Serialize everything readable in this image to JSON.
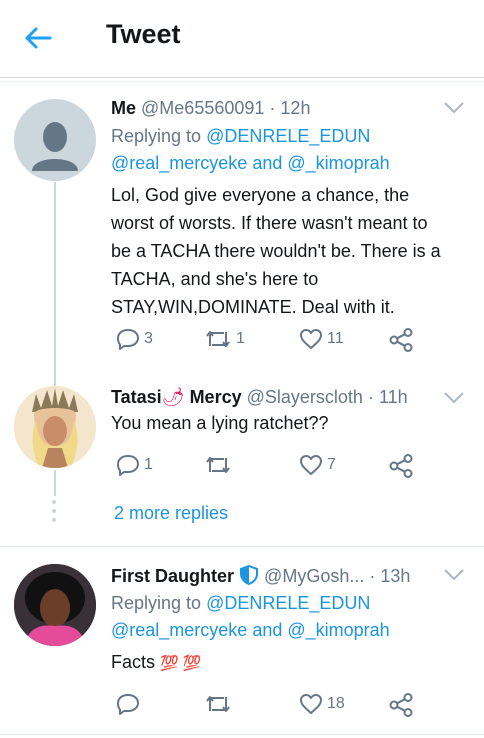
{
  "header": {
    "title": "Tweet",
    "back_icon": "arrow-left-icon"
  },
  "tweets": [
    {
      "name": "Me",
      "handle": "@Me65560091",
      "time": "· 12h",
      "replying_label": "Replying to",
      "replying_first": "@DENRELE_EDUN",
      "replying_second_line": "@real_mercyeke and @_kimoprah",
      "text_lines": [
        "Lol, God give everyone a chance, the",
        "worst of worsts. If there wasn't meant to",
        "be a TACHA there wouldn't be. There is a",
        "TACHA, and she's here to",
        "STAY,WIN,DOMINATE. Deal with it."
      ],
      "replies": "3",
      "retweets": "1",
      "likes": "11"
    },
    {
      "name_prefix": "Tatasi",
      "name_emoji": "🌶",
      "name_suffix": "Mercy",
      "handle": "@Slayerscloth",
      "time": "· 11h",
      "text": "You mean a lying ratchet??",
      "replies": "1",
      "retweets": "",
      "likes": "7"
    },
    {
      "name": "First Daughter",
      "handle": "@MyGosh...",
      "time": "· 13h",
      "replying_label": "Replying to",
      "replying_first": "@DENRELE_EDUN",
      "replying_second_line": "@real_mercyeke and @_kimoprah",
      "text": "Facts",
      "text_emoji": "💯 💯",
      "replies": "",
      "retweets": "",
      "likes": "18"
    }
  ],
  "more_replies": "2 more replies",
  "colors": {
    "link": "#1b95e0",
    "muted": "#657786",
    "text": "#14171a",
    "line": "#ccd6dd",
    "emoji_100": "#e0245e"
  }
}
